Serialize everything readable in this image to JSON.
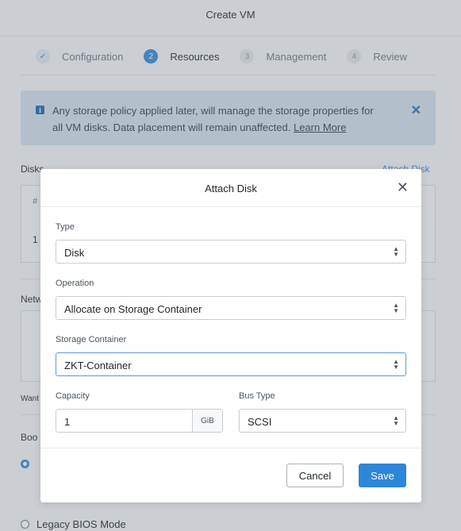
{
  "page": {
    "title": "Create VM",
    "steps": [
      {
        "num": "✓",
        "label": "Configuration",
        "state": "done"
      },
      {
        "num": "2",
        "label": "Resources",
        "state": "active"
      },
      {
        "num": "3",
        "label": "Management",
        "state": "pending"
      },
      {
        "num": "4",
        "label": "Review",
        "state": "pending"
      }
    ],
    "info_banner": {
      "icon": "info-icon",
      "text_line1": "Any storage policy applied later, will manage the storage properties for",
      "text_line2": "all VM disks. Data placement will remain unaffected.",
      "link": "Learn More",
      "close": "✕"
    },
    "disks": {
      "label": "Disks",
      "attach_link": "Attach Disk",
      "col_hash": "#",
      "row_num": "1"
    },
    "networks_label": "Netw",
    "want_text": "Want",
    "boot_label": "Boo",
    "legacy_bios": "Legacy BIOS Mode"
  },
  "modal": {
    "title": "Attach Disk",
    "close_icon": "✕",
    "type": {
      "label": "Type",
      "value": "Disk"
    },
    "operation": {
      "label": "Operation",
      "value": "Allocate on Storage Container"
    },
    "storage_container": {
      "label": "Storage Container",
      "value": "ZKT-Container"
    },
    "capacity": {
      "label": "Capacity",
      "value": "1",
      "unit": "GiB"
    },
    "bus_type": {
      "label": "Bus Type",
      "value": "SCSI"
    },
    "cancel": "Cancel",
    "save": "Save"
  },
  "colors": {
    "accent": "#2d86d9",
    "banner": "#cfdfee"
  }
}
